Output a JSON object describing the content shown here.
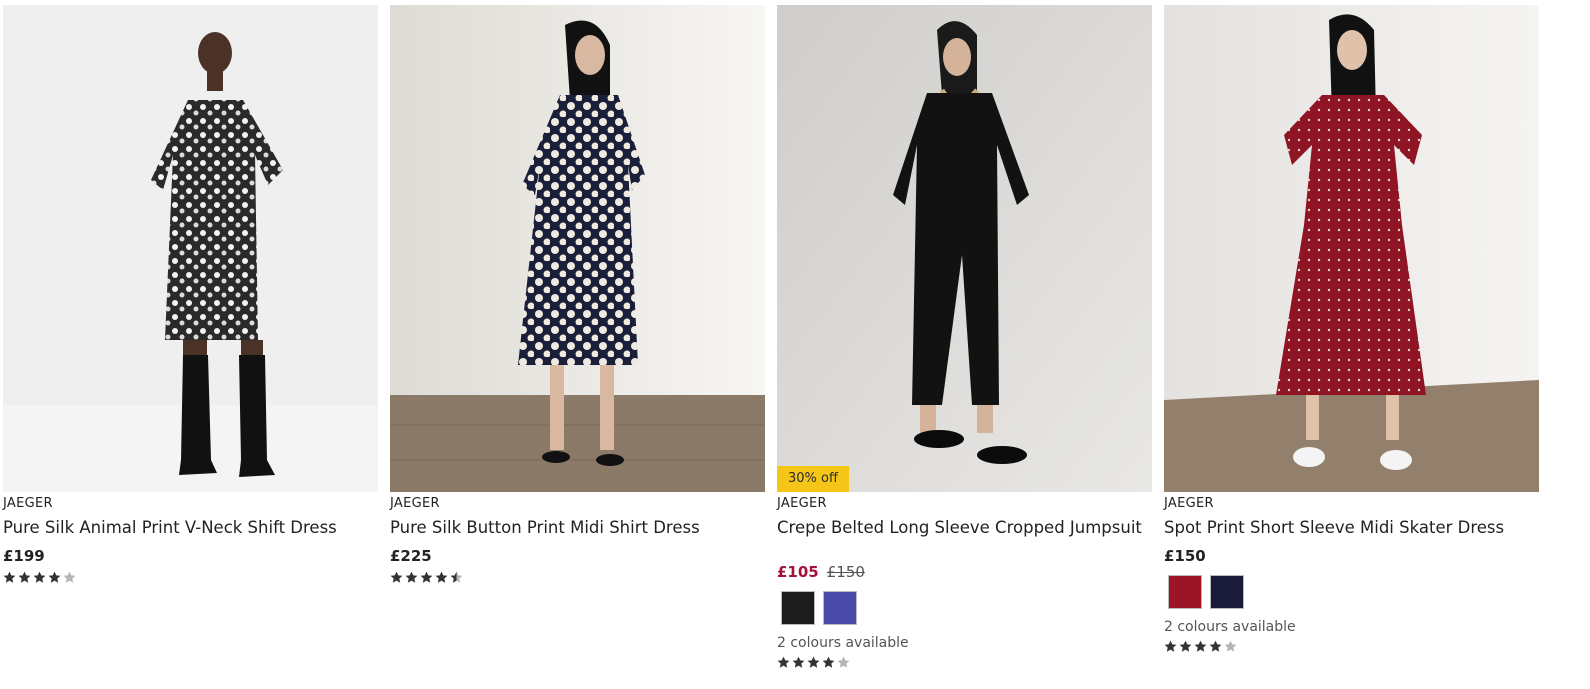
{
  "products": [
    {
      "brand": "JAEGER",
      "title": "Pure Silk Animal Print V-Neck Shift Dress",
      "price": "£199",
      "rating": 4,
      "image_icon": "model-photo-animal-print-dress"
    },
    {
      "brand": "JAEGER",
      "title": "Pure Silk Button Print Midi Shirt Dress",
      "price": "£225",
      "rating": 4.5,
      "image_icon": "model-photo-spot-shirt-dress"
    },
    {
      "brand": "JAEGER",
      "title": "Crepe Belted Long Sleeve Cropped Jumpsuit",
      "badge": "30% off",
      "sale_price": "£105",
      "was_price": "£150",
      "swatches": [
        "#1c1c1c",
        "#4a4aa8"
      ],
      "colours_text": "2 colours available",
      "rating": 4,
      "image_icon": "model-photo-black-jumpsuit"
    },
    {
      "brand": "JAEGER",
      "title": "Spot Print Short Sleeve Midi Skater Dress",
      "price": "£150",
      "swatches": [
        "#9b1526",
        "#1a1a3a"
      ],
      "colours_text": "2 colours available",
      "rating": 4,
      "image_icon": "model-photo-red-spot-dress"
    }
  ],
  "colors": {
    "sale_price": "#a3123a",
    "badge_bg": "#f5c518",
    "star_filled": "#333333",
    "star_empty": "#b5b5b5"
  }
}
